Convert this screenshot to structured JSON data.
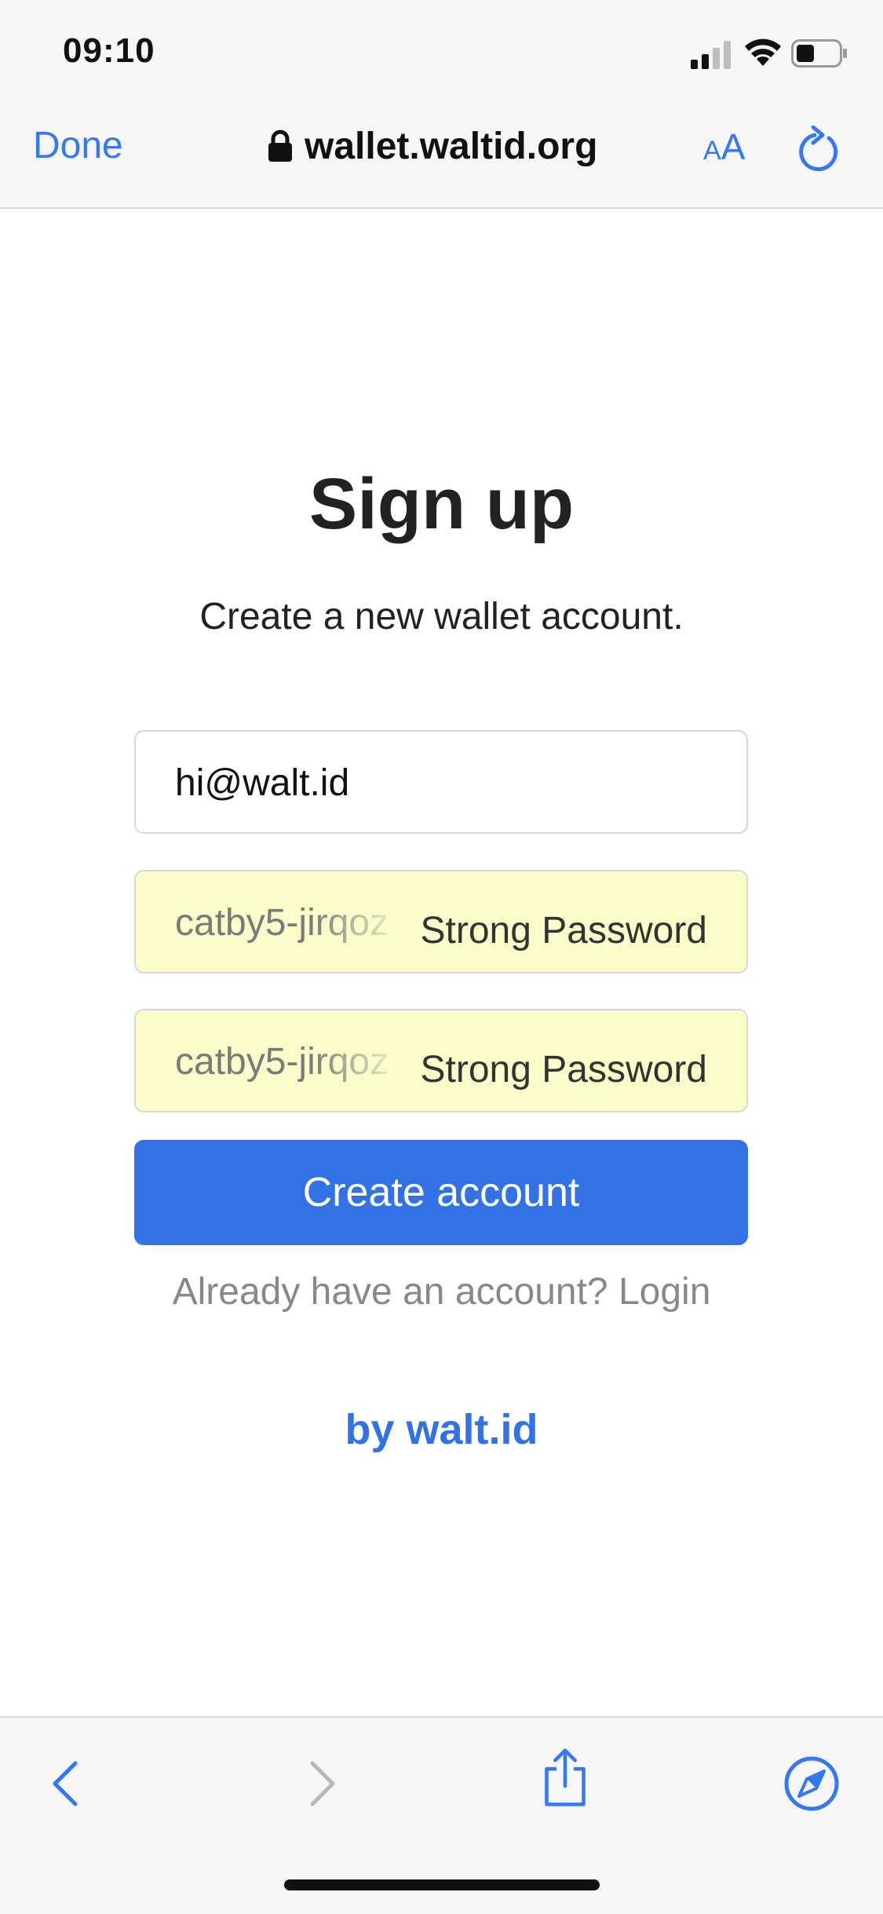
{
  "status_bar": {
    "time": "09:10"
  },
  "browser": {
    "done_label": "Done",
    "url": "wallet.waltid.org",
    "text_size_small": "A",
    "text_size_large": "A"
  },
  "page": {
    "title": "Sign up",
    "subtitle": "Create a new wallet account.",
    "email_value": "hi@walt.id",
    "password_value": "catby5-jirqoz",
    "password_strength_label": "Strong Password",
    "confirm_value": "catby5-jirqoz",
    "confirm_strength_label": "Strong Password",
    "create_button_label": "Create account",
    "login_prompt": "Already have an account? ",
    "login_link_label": "Login",
    "brand_link": "by walt.id"
  },
  "colors": {
    "accent": "#3272e5",
    "ios_blue": "#3478f6",
    "autofill_background": "#fafdc9",
    "muted_text": "#888888"
  },
  "icons": {
    "lock": "lock-icon",
    "reload": "reload-icon",
    "back": "chevron-left-icon",
    "forward": "chevron-right-icon",
    "share": "share-icon",
    "safari": "compass-icon",
    "signal": "cellular-signal-icon",
    "wifi": "wifi-icon",
    "battery": "battery-icon"
  }
}
